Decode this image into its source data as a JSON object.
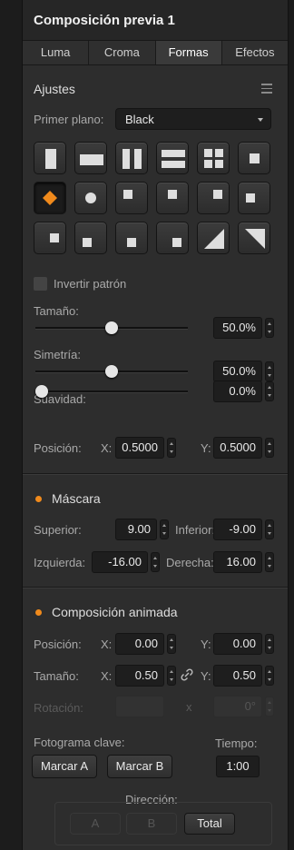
{
  "panel": {
    "title": "Composición previa 1"
  },
  "tabs": [
    {
      "label": "Luma",
      "active": false
    },
    {
      "label": "Croma",
      "active": false
    },
    {
      "label": "Formas",
      "active": true
    },
    {
      "label": "Efectos",
      "active": false
    }
  ],
  "ajustes": {
    "header": "Ajustes",
    "foreground_label": "Primer plano:",
    "foreground_value": "Black",
    "wipe_patterns": [
      "vertical-bar",
      "horizontal-bar",
      "vertical-barn-door",
      "horizontal-barn-door",
      "four-box",
      "box-center",
      "diamond",
      "circle",
      "top-left-box",
      "top-center-box",
      "top-right-box",
      "left-middle-box",
      "right-middle-box",
      "bottom-left-box",
      "bottom-center-box",
      "bottom-right-box",
      "diagonal-left",
      "diagonal-right"
    ],
    "selected_pattern": "diamond",
    "invert_label": "Invertir patrón",
    "invert_checked": false,
    "size_label": "Tamaño:",
    "size_value": "50.0%",
    "size_fraction": 0.5,
    "symmetry_label": "Simetría:",
    "symmetry_value": "50.0%",
    "symmetry_fraction": 0.5,
    "softness_label": "Suavidad:",
    "softness_value": "0.0%",
    "softness_fraction": 0.0,
    "position_label": "Posición:",
    "x_label": "X:",
    "x_value": "0.5000",
    "y_label": "Y:",
    "y_value": "0.5000"
  },
  "mascara": {
    "header": "Máscara",
    "enabled": true,
    "top_label": "Superior:",
    "top_value": "9.00",
    "bottom_label": "Inferior:",
    "bottom_value": "-9.00",
    "left_label": "Izquierda:",
    "left_value": "-16.00",
    "right_label": "Derecha:",
    "right_value": "16.00"
  },
  "animated": {
    "header": "Composición animada",
    "enabled": true,
    "position_label": "Posición:",
    "pos_x_label": "X:",
    "pos_x_value": "0.00",
    "pos_y_label": "Y:",
    "pos_y_value": "0.00",
    "size_label": "Tamaño:",
    "size_x_label": "X:",
    "size_x_value": "0.50",
    "size_y_label": "Y:",
    "size_y_value": "0.50",
    "rotation_label": "Rotación:",
    "rotation_x": "x",
    "rotation_value": "0°",
    "keyframe_label": "Fotograma clave:",
    "mark_a_label": "Marcar A",
    "mark_b_label": "Marcar B",
    "time_label": "Tiempo:",
    "time_value": "1:00",
    "direction_label": "Dirección:",
    "dir_a_label": "A",
    "dir_b_label": "B",
    "dir_total_label": "Total"
  },
  "colors": {
    "accent": "#f08a1c",
    "panel": "#2d2d2d",
    "field": "#1e1e1e"
  }
}
